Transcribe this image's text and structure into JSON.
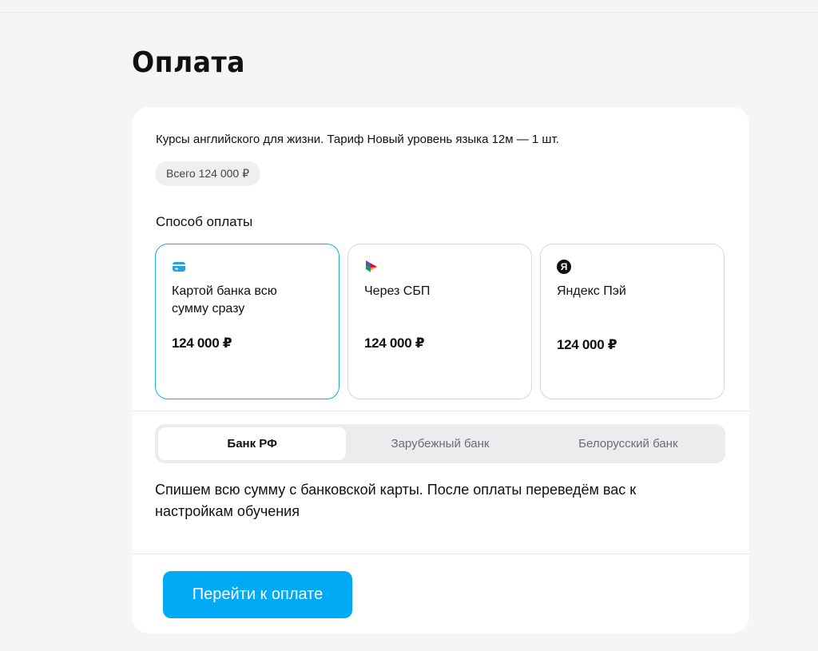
{
  "page": {
    "title": "Оплата"
  },
  "order": {
    "product": "Курсы английского для жизни. Тариф Новый уровень языка 12м — 1 шт.",
    "total": "Всего 124 000 ₽"
  },
  "payment": {
    "heading": "Способ оплаты",
    "methods": [
      {
        "label": "Картой банка всю сумму сразу",
        "price": "124 000 ₽",
        "icon": "card-icon",
        "selected": true
      },
      {
        "label": "Через СБП",
        "price": "124 000 ₽",
        "icon": "sbp-icon",
        "selected": false
      },
      {
        "label": "Яндекс Пэй",
        "price": "124 000 ₽",
        "icon": "yandex-icon",
        "icon_glyph": "Я",
        "selected": false
      }
    ]
  },
  "bank_tabs": [
    {
      "label": "Банк РФ",
      "active": true
    },
    {
      "label": "Зарубежный банк",
      "active": false
    },
    {
      "label": "Белорусский банк",
      "active": false
    }
  ],
  "description": "Спишем всю сумму с банковской карты. После оплаты переведём вас к настройкам обучения",
  "actions": {
    "pay_label": "Перейти к оплате"
  },
  "colors": {
    "accent": "#00aaf5",
    "selected_border": "#1ba7e6",
    "background": "#f5f5f6"
  }
}
